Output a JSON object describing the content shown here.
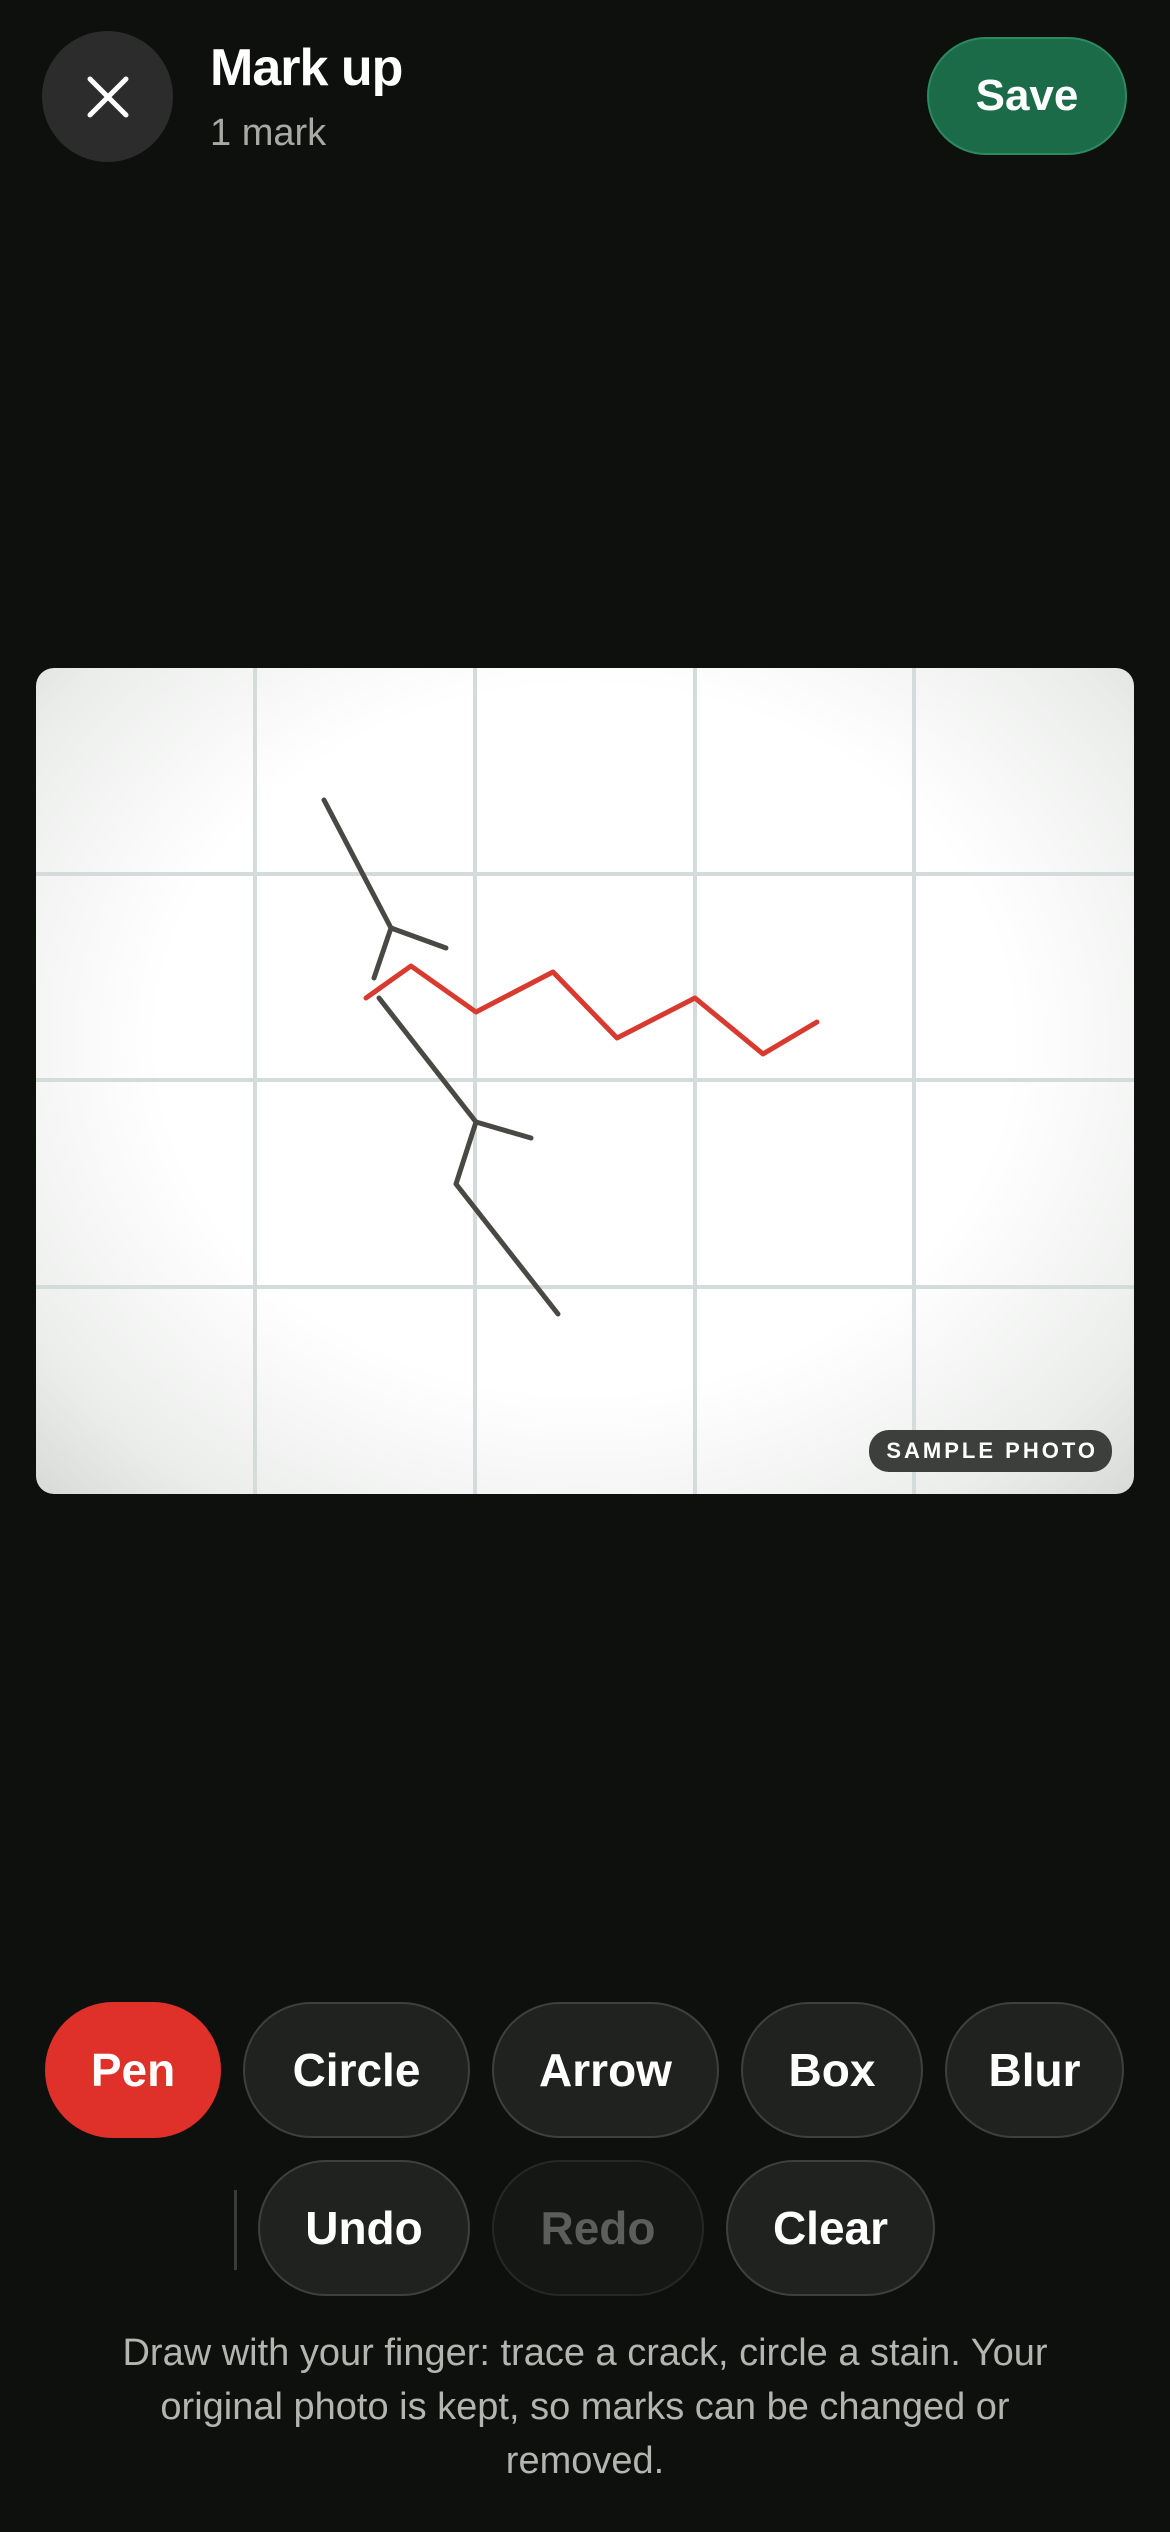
{
  "header": {
    "title": "Mark up",
    "subtitle": "1 mark",
    "close_icon": "close-icon",
    "save_label": "Save"
  },
  "photo": {
    "badge": "SAMPLE PHOTO",
    "mark_color": "#d93a2f",
    "crack_color": "#4a4843"
  },
  "tools": {
    "pen": "Pen",
    "circle": "Circle",
    "arrow": "Arrow",
    "box": "Box",
    "blur": "Blur",
    "active": "Pen"
  },
  "actions": {
    "undo": "Undo",
    "redo": "Redo",
    "clear": "Clear"
  },
  "hint": "Draw with your finger: trace a crack, circle a stain. Your original photo is kept, so marks can be changed or removed.",
  "colors": {
    "background": "#0e100e",
    "accent_save": "#1b6a48",
    "accent_active": "#e0302a"
  }
}
